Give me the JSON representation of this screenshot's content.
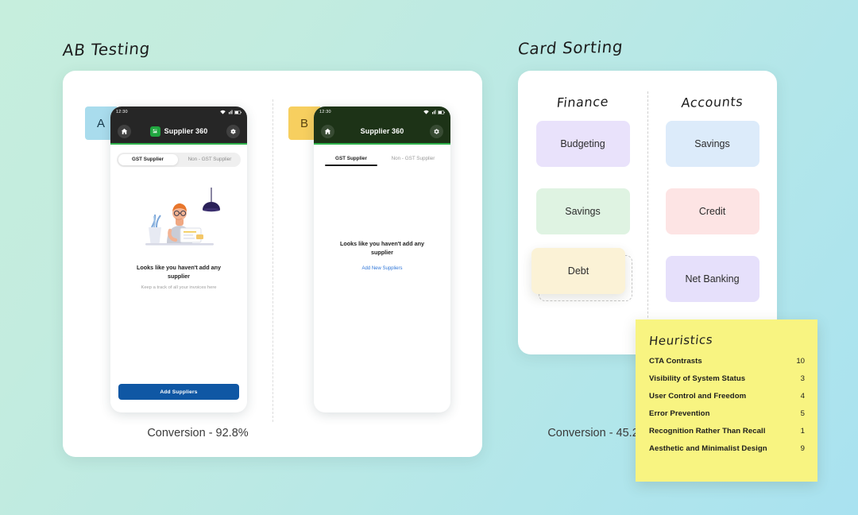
{
  "theme": {
    "bg_from": "#c6eedd",
    "bg_to": "#a9e2f0",
    "panel_bg": "#ffffff",
    "sticky_bg": "#f8f481",
    "cta_blue": "#0f57a4",
    "link_blue": "#2f76d8",
    "accent_green": "#2fb24c"
  },
  "ab_testing": {
    "title": "AB Testing",
    "variants": [
      {
        "badge": "A",
        "badge_color": "#a9dced",
        "conversion_label": "Conversion - 92.8%",
        "conversion_value": 92.8,
        "phone": {
          "status_time": "12:30",
          "header_bg": "#262626",
          "app_title": "Supplier 360",
          "home_icon": "home-icon",
          "settings_icon": "gear-icon",
          "app_icon": "app-logo-icon",
          "tabs_style": "pill",
          "tabs": [
            {
              "label": "GST Supplier",
              "active": true
            },
            {
              "label": "Non - GST Supplier",
              "active": false
            }
          ],
          "empty_title": "Looks like you haven't add any supplier",
          "empty_subtitle": "Keep a track of all your invoices here",
          "illustration": "person-with-clipboard-illustration",
          "cta_type": "button",
          "cta_label": "Add Suppliers"
        }
      },
      {
        "badge": "B",
        "badge_color": "#f7cf5f",
        "conversion_label": "Conversion - 45.2%",
        "conversion_value": 45.2,
        "phone": {
          "status_time": "12:30",
          "header_bg": "#1d3317",
          "app_title": "Supplier 360",
          "home_icon": "home-icon",
          "settings_icon": "gear-icon",
          "tabs_style": "underline",
          "tabs": [
            {
              "label": "GST Supplier",
              "active": true
            },
            {
              "label": "Non - GST Supplier",
              "active": false
            }
          ],
          "empty_title": "Looks like you haven't add any supplier",
          "cta_type": "link",
          "cta_label": "Add New Suppliers"
        }
      }
    ]
  },
  "card_sorting": {
    "title": "Card Sorting",
    "columns": [
      {
        "title": "Finance",
        "cards": [
          {
            "label": "Budgeting",
            "color": "#e9e2fb",
            "state": "placed"
          },
          {
            "label": "Savings",
            "color": "#dff3e2",
            "state": "placed"
          },
          {
            "label": "Debt",
            "color": "#fbf2d6",
            "state": "dragging"
          }
        ]
      },
      {
        "title": "Accounts",
        "cards": [
          {
            "label": "Savings",
            "color": "#dcebfa",
            "state": "placed"
          },
          {
            "label": "Credit",
            "color": "#fde4e4",
            "state": "placed"
          },
          {
            "label": "Net Banking",
            "color": "#e6e0fb",
            "state": "placed"
          }
        ]
      }
    ]
  },
  "heuristics": {
    "title": "Heuristics",
    "rows": [
      {
        "name": "CTA Contrasts",
        "score": "10"
      },
      {
        "name": "Visibility of System Status",
        "score": "3"
      },
      {
        "name": "User Control and Freedom",
        "score": "4"
      },
      {
        "name": "Error Prevention",
        "score": "5"
      },
      {
        "name": "Recognition Rather Than Recall",
        "score": "1"
      },
      {
        "name": "Aesthetic and Minimalist Design",
        "score": "9"
      }
    ]
  }
}
